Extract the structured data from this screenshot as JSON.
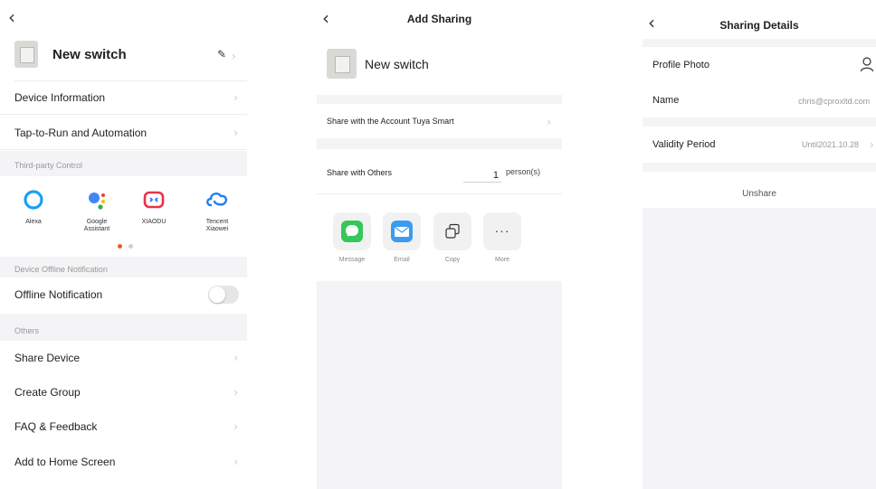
{
  "screen1": {
    "device_name": "New switch",
    "rows": {
      "device_information": "Device Information",
      "tap_to_run": "Tap-to-Run and Automation"
    },
    "third_party_header": "Third-party Control",
    "third_party": [
      {
        "name": "Alexa",
        "icon": "alexa-icon"
      },
      {
        "name": "Google\nAssistant",
        "icon": "google-assistant-icon"
      },
      {
        "name": "XIAODU",
        "icon": "xiaodu-icon"
      },
      {
        "name": "Tencent\nXiaowei",
        "icon": "tencent-xiaowei-icon"
      }
    ],
    "offline_header": "Device Offline Notification",
    "offline_label": "Offline Notification",
    "others_header": "Others",
    "others": {
      "share_device": "Share Device",
      "create_group": "Create Group",
      "faq": "FAQ & Feedback",
      "home_screen": "Add to Home Screen"
    }
  },
  "screen2": {
    "title": "Add Sharing",
    "device_name": "New switch",
    "share_account": "Share with the Account Tuya Smart",
    "share_others": "Share with Others",
    "person_count": "1",
    "person_unit": "person(s)",
    "apps": {
      "message": "Message",
      "email": "Email",
      "copy": "Copy",
      "more": "More"
    }
  },
  "screen3": {
    "title": "Sharing Details",
    "profile_photo_label": "Profile Photo",
    "name_label": "Name",
    "name_value": "chris@cproxltd.com",
    "validity_label": "Validity Period",
    "validity_value": "Until2021.10.28",
    "unshare": "Unshare"
  },
  "colors": {
    "section_bg": "#f4f4f6",
    "message_green": "#34c759",
    "email_blue": "#3a9cf0",
    "alexa_blue": "#1ba0f2",
    "xiaodu_red": "#e8334a",
    "tencent_blue": "#1e7ef3",
    "page_dot_active": "#f05a28"
  }
}
